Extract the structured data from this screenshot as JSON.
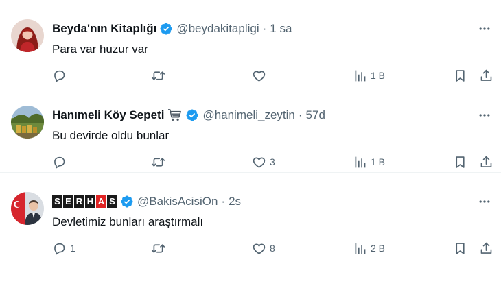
{
  "tweets": [
    {
      "name": "Beyda'nın Kitaplığı",
      "handle": "@beydakitapligi",
      "separator": "·",
      "time": "1 sa",
      "text": "Para var huzur var",
      "replies": "",
      "retweets": "",
      "likes": "",
      "views": "1 B",
      "avatar_icon": "woman-portrait-icon",
      "verified": true
    },
    {
      "name": "Hanımeli Köy Sepeti",
      "handle": "@hanimeli_zeytin",
      "separator": "·",
      "time": "57d",
      "text": "Bu devirde oldu bunlar",
      "replies": "",
      "retweets": "",
      "likes": "3",
      "views": "1 B",
      "avatar_icon": "garden-landscape-icon",
      "name_emoji": "shopping-cart-icon",
      "verified": true
    },
    {
      "name_letters": [
        "S",
        "E",
        "R",
        "H",
        "A",
        "S"
      ],
      "handle": "@BakisAcisiOn",
      "separator": "·",
      "time": "2s",
      "text": "Devletimiz bunları araştırmalı",
      "replies": "1",
      "retweets": "",
      "likes": "8",
      "views": "2 B",
      "avatar_icon": "turkish-flag-portrait-icon",
      "verified": true
    }
  ],
  "colors": {
    "text": "#0f1419",
    "secondary": "#536471",
    "verified": "#1d9bf0",
    "divider": "#eff3f4",
    "serhas_dark": "#1a1a1a",
    "serhas_red": "#e02424"
  }
}
